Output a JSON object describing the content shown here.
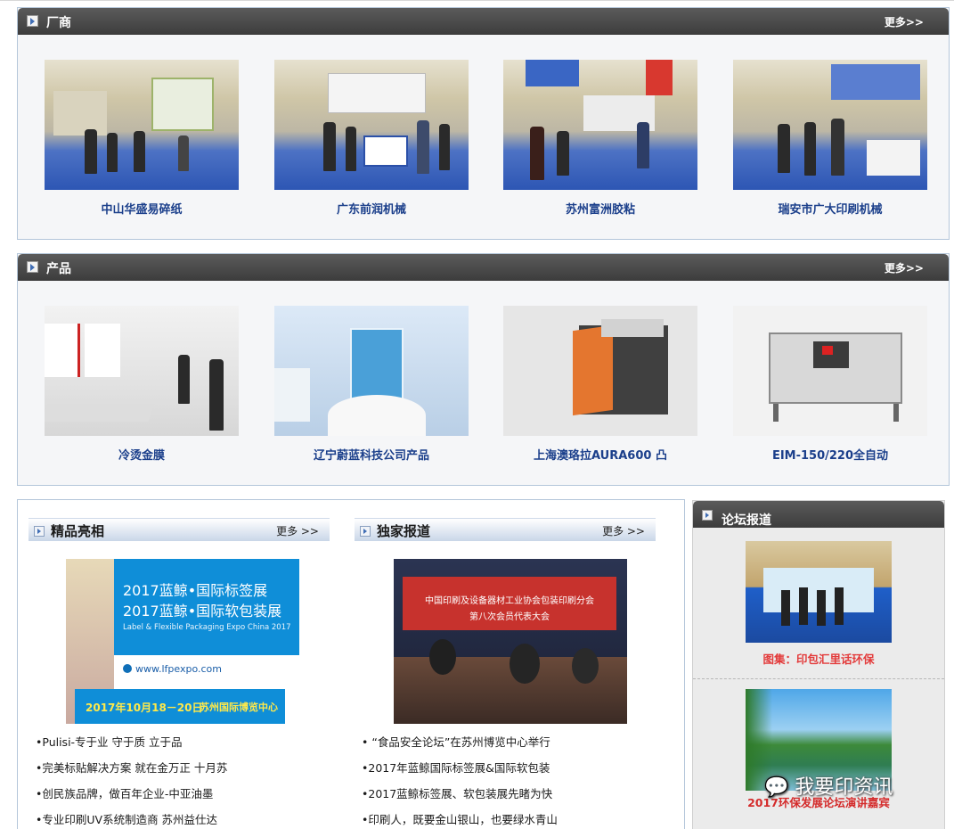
{
  "vendors": {
    "title": "厂商",
    "more_label": "更多>>",
    "items": [
      {
        "label": "中山华盛易碎纸"
      },
      {
        "label": "广东前润机械"
      },
      {
        "label": "苏州富洲胶粘"
      },
      {
        "label": "瑞安市广大印刷机械"
      }
    ]
  },
  "products": {
    "title": "产品",
    "more_label": "更多>>",
    "items": [
      {
        "label": "冷烫金膜"
      },
      {
        "label": "辽宁蔚蓝科技公司产品"
      },
      {
        "label": "上海澳珞拉AURA600 凸"
      },
      {
        "label": "EIM-150/220全自动"
      }
    ]
  },
  "featured": {
    "title": "精品亮相",
    "more_label": "更多 >>",
    "banner": {
      "line1": "2017蓝鲸•国际标签展",
      "line2": "2017蓝鲸•国际软包装展",
      "subtitle": "Label & Flexible Packaging Expo China 2017",
      "url": "www.lfpexpo.com",
      "date": "2017年10月18－20日",
      "venue": "苏州国际博览中心"
    },
    "list": [
      "•Pulisi-专于业 守于质 立于品",
      "•完美标贴解决方案 就在金万正 十月苏",
      "•创民族品牌，做百年企业-中亚油墨",
      "•专业印刷UV系统制造商 苏州益仕达"
    ]
  },
  "exclusive": {
    "title": "独家报道",
    "more_label": "更多 >>",
    "photo": {
      "banner_line1": "中国印刷及设备器材工业协会包装印刷分会",
      "banner_line2": "第八次会员代表大会"
    },
    "list": [
      "• “食品安全论坛”在苏州博览中心举行",
      "•2017年蓝鲸国际标签展&国际软包装",
      "•2017蓝鲸标签展、软包装展先睹为快",
      "•印刷人，既要金山银山，也要绿水青山"
    ]
  },
  "forum": {
    "title": "论坛报道",
    "items": [
      {
        "label": "图集：印包汇里话环保"
      },
      {
        "label": "2017环保发展论坛演讲嘉宾"
      }
    ],
    "watermark": "我要印资讯"
  },
  "colors": {
    "header_bg": "#444444",
    "caption_blue": "#1b3f8b",
    "forum_red": "#e33b3b",
    "panel_border": "#b4c6da"
  }
}
